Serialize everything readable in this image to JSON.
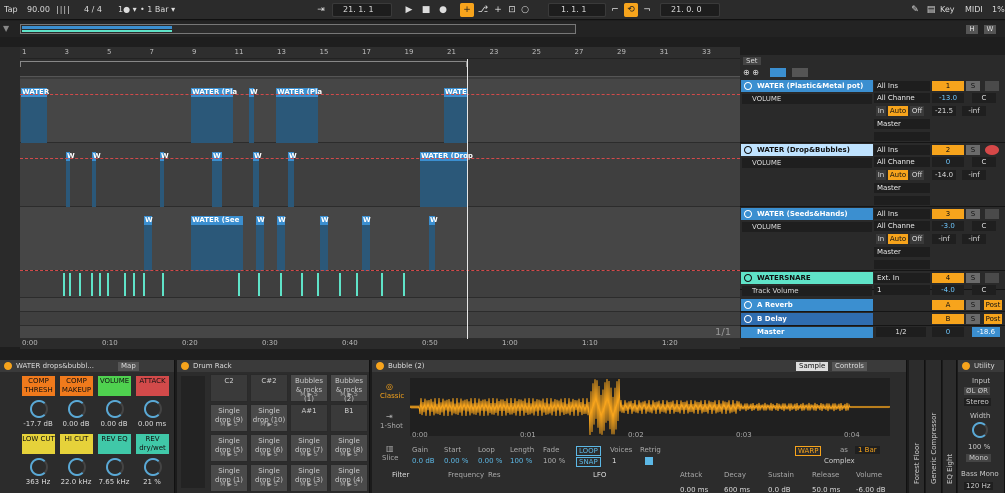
{
  "transport": {
    "tap": "Tap",
    "tempo": "90.00",
    "sig": "4 / 4",
    "quant": "1 Bar",
    "pos1": "21.   1.   1",
    "pos2": "1.   1.   1",
    "pos3": "21.   0.   0",
    "key": "Key",
    "midi": "MIDI",
    "cpu": "1%",
    "h": "H",
    "w": "W"
  },
  "ruler": {
    "bars": [
      "1",
      "3",
      "5",
      "7",
      "9",
      "11",
      "13",
      "15",
      "17",
      "19",
      "21",
      "23",
      "25",
      "27",
      "29",
      "31",
      "33"
    ]
  },
  "timeline": {
    "labels": [
      "0:00",
      "0:10",
      "0:20",
      "0:30",
      "0:40",
      "0:50",
      "1:00",
      "1:10",
      "1:20"
    ],
    "page": "1/1"
  },
  "set_label": "Set",
  "tracks": [
    {
      "name": "WATER (Plastic&Metal pot)",
      "param": "VOLUME",
      "input": "All Ins",
      "channel": "All Channe",
      "mon_in": "In",
      "mon_auto": "Auto",
      "mon_off": "Off",
      "out": "Master",
      "num": "1",
      "vol": "-13.0",
      "pan": "C",
      "peak1": "-21.5",
      "peak2": "-inf",
      "solo": "S",
      "color": "#3b8fd0"
    },
    {
      "name": "WATER (Drop&Bubbles)",
      "param": "VOLUME",
      "input": "All Ins",
      "channel": "All Channe",
      "mon_in": "In",
      "mon_auto": "Auto",
      "mon_off": "Off",
      "out": "Master",
      "num": "2",
      "vol": "0",
      "pan": "C",
      "peak1": "-14.0",
      "peak2": "-inf",
      "solo": "S",
      "color": "#3b8fd0"
    },
    {
      "name": "WATER (Seeds&Hands)",
      "param": "VOLUME",
      "input": "All Ins",
      "channel": "All Channe",
      "mon_in": "In",
      "mon_auto": "Auto",
      "mon_off": "Off",
      "out": "Master",
      "num": "3",
      "vol": "-3.0",
      "pan": "C",
      "peak1": "-inf",
      "peak2": "-inf",
      "solo": "S",
      "color": "#3b8fd0"
    },
    {
      "name": "WATERSNARE",
      "param": "Track Volume",
      "input": "Ext. In",
      "channel": "1",
      "out": "",
      "num": "4",
      "vol": "-4.0",
      "pan": "C",
      "solo": "S",
      "color": "#5fe3c8"
    }
  ],
  "returns": [
    {
      "name": "A Reverb",
      "letter": "A",
      "solo": "S",
      "post": "Post"
    },
    {
      "name": "B Delay",
      "letter": "B",
      "solo": "S",
      "post": "Post"
    }
  ],
  "master": {
    "name": "Master",
    "cue": "1/2",
    "vol": "0",
    "peak": "-18.6"
  },
  "clips": {
    "t1": [
      "WATER",
      "WATER (Pla",
      "W",
      "WATER (Pla",
      "WATE"
    ],
    "t2": [
      "W",
      "W",
      "W",
      "W",
      "W",
      "W",
      "WATER (Drop"
    ],
    "t3": [
      "W",
      "WATER (See",
      "W",
      "W",
      "W",
      "W",
      "W"
    ]
  },
  "rack": {
    "title": "WATER drops&bubbl...",
    "map": "Map",
    "macros": [
      {
        "label": "COMP THRESH",
        "value": "-17.7 dB",
        "color": "#f07a1c"
      },
      {
        "label": "COMP MAKEUP",
        "value": "0.00 dB",
        "color": "#f07a1c"
      },
      {
        "label": "VOLUME",
        "value": "0.00 dB",
        "color": "#4fd14f"
      },
      {
        "label": "ATTACK",
        "value": "0.00 ms",
        "color": "#d24a4a"
      },
      {
        "label": "LOW CUT",
        "value": "363 Hz",
        "color": "#e6d23a"
      },
      {
        "label": "HI CUT",
        "value": "22.0 kHz",
        "color": "#e6d23a"
      },
      {
        "label": "REV EQ",
        "value": "7.65 kHz",
        "color": "#40c8a8"
      },
      {
        "label": "REV dry/wet",
        "value": "21 %",
        "color": "#40c8a8"
      }
    ]
  },
  "drumrack": {
    "title": "Drum Rack",
    "row1": [
      "C2",
      "C#2",
      "Bubbles & rocks (1)",
      "Bubbles & rocks (2)"
    ],
    "row2": [
      "Single drop (9)",
      "Single drop (10)",
      "A#1",
      "B1"
    ],
    "row3": [
      "Single drop (5)",
      "Single drop (6)",
      "Single drop (7)",
      "Single drop (8)"
    ],
    "row4": [
      "Single drop (1)",
      "Single drop (2)",
      "Single drop (3)",
      "Single drop (4)"
    ],
    "mini": "M  ▶  S"
  },
  "sampler": {
    "title": "Bubble (2)",
    "tab_sample": "Sample",
    "tab_controls": "Controls",
    "mode": "Classic",
    "oneshot": "1-Shot",
    "slice": "Slice",
    "ticks": [
      "0:00",
      "0:01",
      "0:02",
      "0:03",
      "0:04"
    ],
    "gain_l": "Gain",
    "gain_v": "0.0 dB",
    "start_l": "Start",
    "start_v": "0.00 %",
    "loop_l": "Loop",
    "loop_v": "0.00 %",
    "length_l": "Length",
    "length_v": "100 %",
    "fade_l": "Fade",
    "fade_v": "100 %",
    "loop_btn": "LOOP",
    "snap_btn": "SNAP",
    "voices_l": "Voices",
    "voices_v": "1",
    "retrig_l": "Retrig",
    "warp": "WARP",
    "as": "as",
    "bars": "1 Bar",
    "complex": "Complex",
    "filter": "Filter",
    "freq": "Frequency",
    "res": "Res",
    "lfo": "LFO",
    "attack_l": "Attack",
    "attack_v": "0.00 ms",
    "decay_l": "Decay",
    "decay_v": "600 ms",
    "sustain_l": "Sustain",
    "sustain_v": "0.0 dB",
    "release_l": "Release",
    "release_v": "50.0 ms",
    "volume_l": "Volume",
    "volume_v": "-6.00 dB"
  },
  "side_devices": [
    "Forest Floor",
    "Generic Compressor",
    "EQ Eight"
  ],
  "utility": {
    "title": "Utility",
    "input": "Input",
    "phase": "ØL  ØR",
    "mode": "Stereo",
    "width_l": "Width",
    "width_v": "100 %",
    "mono": "Mono",
    "bass": "Bass Mono",
    "bass_v": "120 Hz"
  }
}
